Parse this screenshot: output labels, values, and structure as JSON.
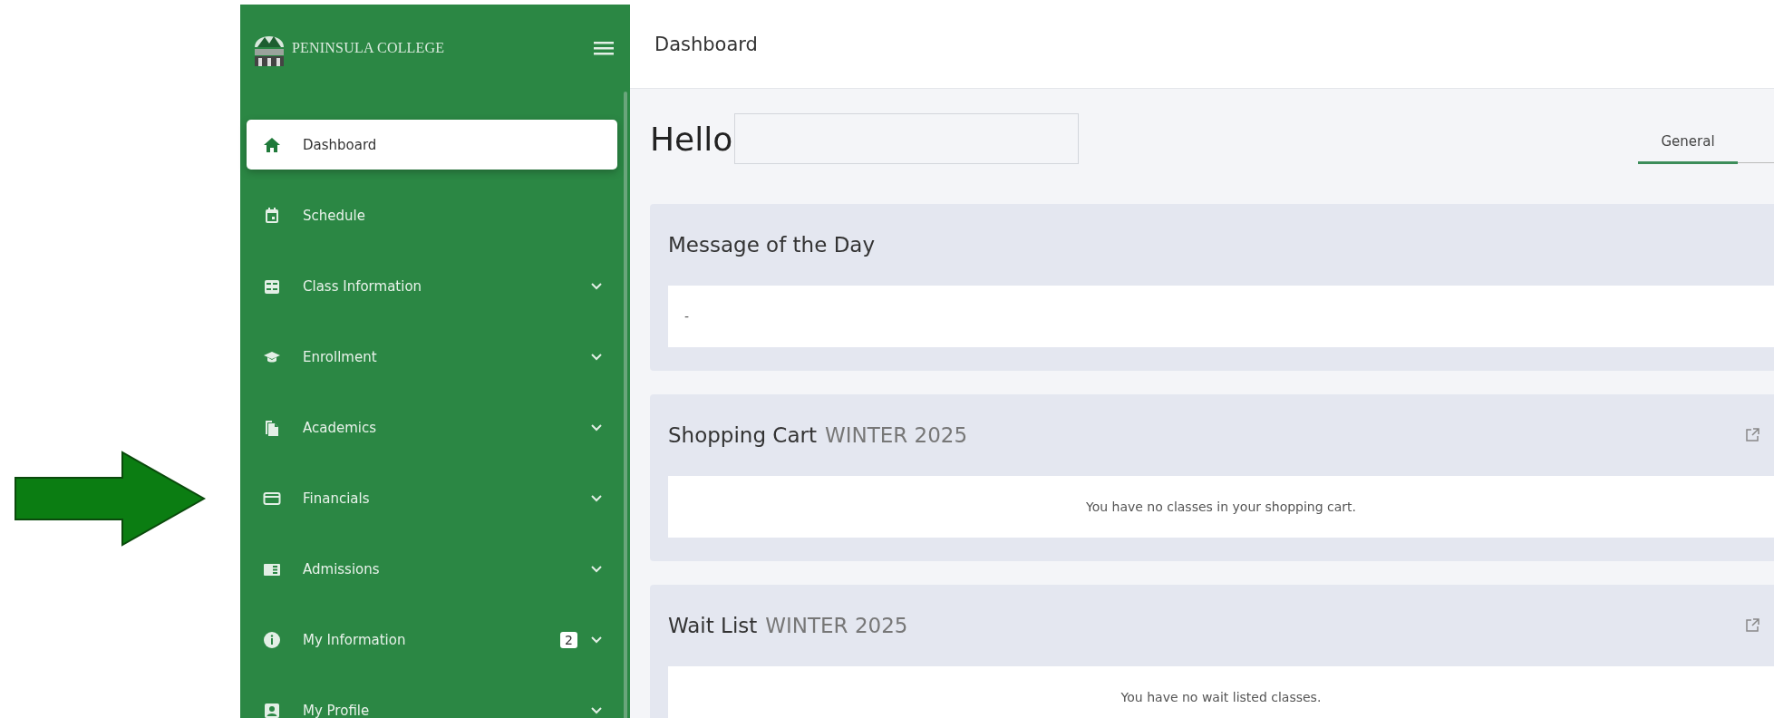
{
  "sidebar": {
    "brand": "PENINSULA COLLEGE",
    "items": [
      {
        "kind": "home",
        "label": "Dashboard",
        "selected": true,
        "expandable": false
      },
      {
        "kind": "calendar",
        "label": "Schedule",
        "selected": false,
        "expandable": false
      },
      {
        "kind": "card-list",
        "label": "Class Information",
        "selected": false,
        "expandable": true
      },
      {
        "kind": "cap",
        "label": "Enrollment",
        "selected": false,
        "expandable": true
      },
      {
        "kind": "documents",
        "label": "Academics",
        "selected": false,
        "expandable": true
      },
      {
        "kind": "credit-card",
        "label": "Financials",
        "selected": false,
        "expandable": true
      },
      {
        "kind": "newspaper",
        "label": "Admissions",
        "selected": false,
        "expandable": true
      },
      {
        "kind": "info",
        "label": "My Information",
        "selected": false,
        "expandable": true,
        "badge": "2"
      },
      {
        "kind": "person",
        "label": "My Profile",
        "selected": false,
        "expandable": true
      }
    ]
  },
  "header": {
    "title": "Dashboard"
  },
  "greeting": "Hello",
  "tabs": [
    {
      "label": "General",
      "selected": true
    }
  ],
  "cards": [
    {
      "kind": "message",
      "title": "Message of the Day",
      "body": "-"
    },
    {
      "kind": "list",
      "title": "Shopping Cart",
      "term": "WINTER 2025",
      "body": "You have no classes in your shopping cart."
    },
    {
      "kind": "list",
      "title": "Wait List",
      "term": "WINTER 2025",
      "body": "You have no wait listed classes."
    }
  ]
}
